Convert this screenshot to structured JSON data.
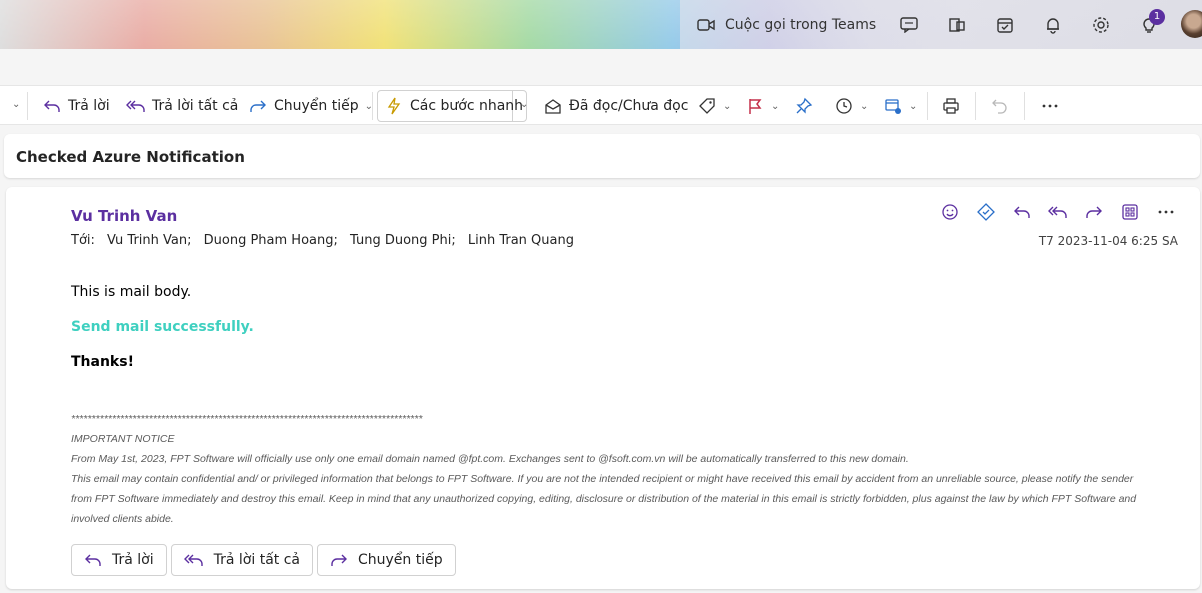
{
  "topbar": {
    "teams_call_label": "Cuộc gọi trong Teams",
    "notification_badge": "1",
    "icons": [
      "video-icon",
      "chat-icon",
      "office-icon",
      "calendar-icon",
      "bell-icon",
      "gear-icon",
      "lightbulb-icon"
    ]
  },
  "toolbar": {
    "reply": "Trả lời",
    "reply_all": "Trả lời tất cả",
    "forward": "Chuyển tiếp",
    "quick_steps": "Các bước nhanh",
    "read_unread": "Đã đọc/Chưa đọc"
  },
  "message": {
    "subject": "Checked Azure Notification",
    "sender": "Vu Trinh Van",
    "to_label": "Tới:",
    "recipients": [
      "Vu Trinh Van;",
      "Duong Pham Hoang;",
      "Tung Duong Phi;",
      "Linh Tran Quang"
    ],
    "date": "T7 2023-11-04 6:25 SA",
    "body": {
      "line1": "This is mail body.",
      "line2": "Send mail successfully.",
      "line3": "Thanks!"
    },
    "notice": {
      "stars": "**************************************************************************************",
      "heading": "IMPORTANT NOTICE",
      "line1": "From May 1st, 2023, FPT Software will officially use only one email domain named @fpt.com. Exchanges sent to @fsoft.com.vn will be automatically transferred to this new domain.",
      "line2": "This email may contain confidential and/ or privileged information that belongs to FPT Software. If you are not the intended recipient or might have received this email by accident from an unreliable source, please notify the sender",
      "line3": "from FPT Software immediately and destroy this email. Keep in mind that any unauthorized copying, editing, disclosure or distribution of the material in this email is strictly forbidden, plus against the law by which FPT Software and",
      "line4": "involved clients abide."
    },
    "buttons": {
      "reply": "Trả lời",
      "reply_all": "Trả lời tất cả",
      "forward": "Chuyển tiếp"
    }
  },
  "colors": {
    "accent": "#5b2fa0",
    "success_text": "#3fd0c0"
  }
}
